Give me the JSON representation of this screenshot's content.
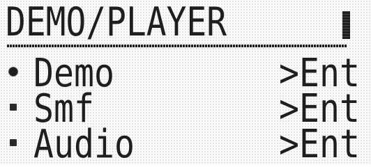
{
  "screen": {
    "title": "DEMO/PLAYER",
    "menu_items": [
      {
        "label": "Demo",
        "action": ">Ent",
        "selected": true
      },
      {
        "label": "Smf",
        "action": ">Ent",
        "selected": false
      },
      {
        "label": "Audio",
        "action": ">Ent",
        "selected": false
      }
    ]
  },
  "colors": {
    "lcd_background": "#fbfbfb",
    "pixel_on": "#1e1e1e",
    "pixel_off": "#e4e4e4"
  }
}
